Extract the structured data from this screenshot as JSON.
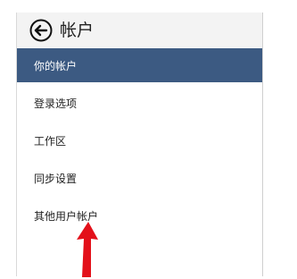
{
  "header": {
    "title": "帐户",
    "back_icon": "back-arrow-circle-icon"
  },
  "nav": {
    "items": [
      {
        "label": "你的帐户",
        "selected": true
      },
      {
        "label": "登录选项",
        "selected": false
      },
      {
        "label": "工作区",
        "selected": false
      },
      {
        "label": "同步设置",
        "selected": false
      },
      {
        "label": "其他用户帐户",
        "selected": false
      }
    ]
  },
  "annotation": {
    "arrow_color": "#e3101a",
    "arrow_icon": "red-pointer-arrow"
  },
  "colors": {
    "selected_bg": "#3c5a82",
    "header_bg": "#f3f3f3"
  }
}
